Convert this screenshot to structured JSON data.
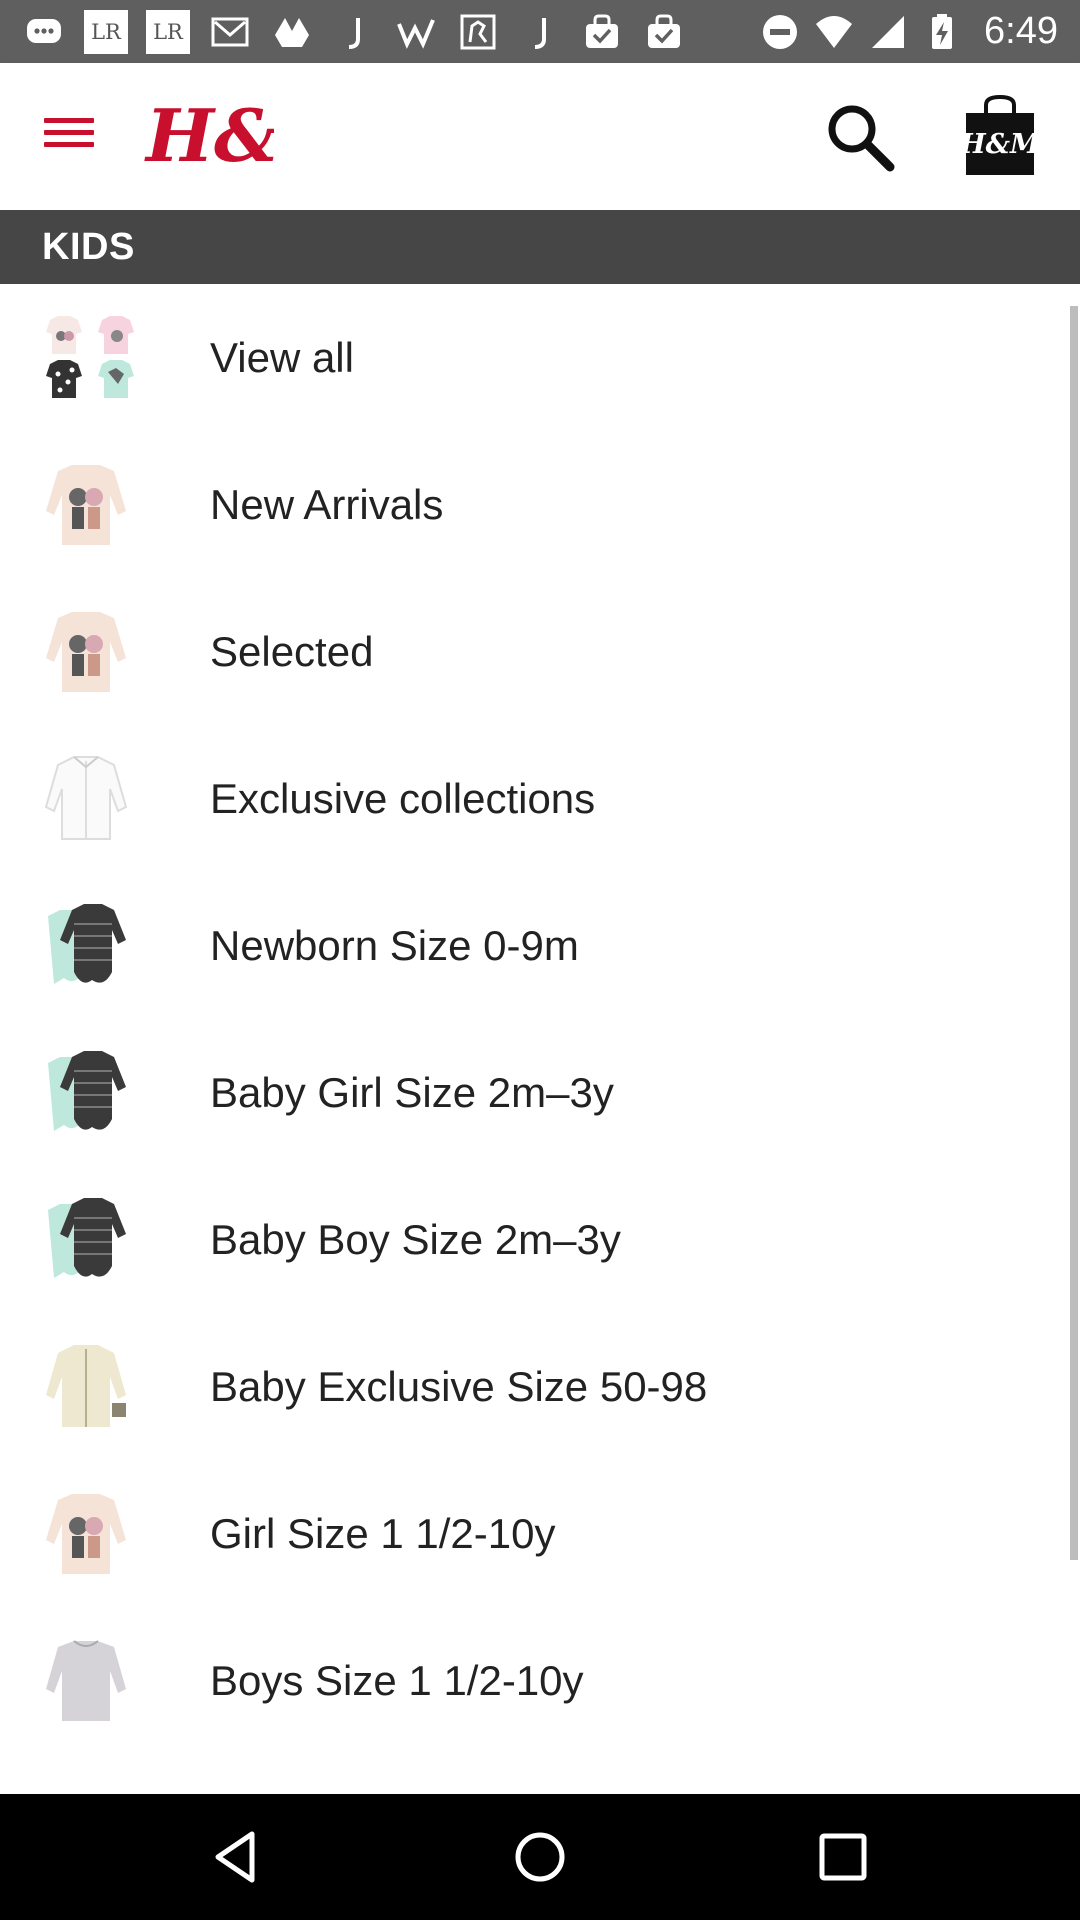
{
  "status_bar": {
    "time": "6:49",
    "notification_icons": [
      "chat-icon",
      "lightroom-icon",
      "lightroom-icon",
      "gmail-icon",
      "drive-icon",
      "j-icon",
      "w-icon",
      "map-icon",
      "j-icon",
      "shopping-bag-icon",
      "shopping-bag-icon"
    ],
    "lr_text": "LR"
  },
  "app_bar": {
    "brand": "H&M",
    "brand_color": "#c8102e",
    "bag_text": "H&M"
  },
  "section": {
    "title": "KIDS"
  },
  "menu_items": [
    {
      "label": "View all",
      "thumb": "four-kids-shirts"
    },
    {
      "label": "New Arrivals",
      "thumb": "cream-kitten-shirt"
    },
    {
      "label": "Selected",
      "thumb": "cream-kitten-shirt"
    },
    {
      "label": "Exclusive collections",
      "thumb": "white-shirt"
    },
    {
      "label": "Newborn Size 0-9m",
      "thumb": "striped-bodysuits"
    },
    {
      "label": "Baby Girl Size 2m–3y",
      "thumb": "striped-bodysuits"
    },
    {
      "label": "Baby Boy Size 2m–3y",
      "thumb": "striped-bodysuits"
    },
    {
      "label": "Baby Exclusive Size 50-98",
      "thumb": "cream-jacket"
    },
    {
      "label": "Girl Size 1 1/2-10y",
      "thumb": "cream-kitten-shirt"
    },
    {
      "label": "Boys Size 1 1/2-10y",
      "thumb": "grey-sweater"
    }
  ],
  "nav_bar": {
    "buttons": [
      "back",
      "home",
      "recents"
    ]
  }
}
